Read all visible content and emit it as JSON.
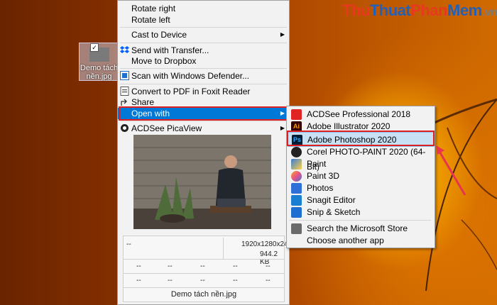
{
  "watermark": {
    "p1": "Thu",
    "p2": "Thuat",
    "p3": "Phan",
    "p4": "Mem",
    "p5": ".vn"
  },
  "desktop_icon": {
    "label": "Demo tách nền.jpg"
  },
  "menu": {
    "items": [
      {
        "label": "Rotate right"
      },
      {
        "label": "Rotate left"
      },
      {
        "label": "Cast to Device"
      },
      {
        "label": "Send with Transfer..."
      },
      {
        "label": "Move to Dropbox"
      },
      {
        "label": "Scan with Windows Defender..."
      },
      {
        "label": "Convert to PDF in Foxit Reader"
      },
      {
        "label": "Share"
      },
      {
        "label": "Open with"
      },
      {
        "label": "ACDSee PicaView"
      }
    ]
  },
  "preview_info": {
    "left_value": "--",
    "dimensions": "1920x1280x24b",
    "size": "944.2 KB",
    "grid": [
      "--",
      "--",
      "--",
      "--",
      "--",
      "--",
      "--",
      "--",
      "--",
      "--"
    ],
    "filename": "Demo tách nền.jpg"
  },
  "submenu": {
    "items": [
      {
        "label": "ACDSee Professional 2018",
        "icon": "acdsee-icon",
        "color": "#e02424"
      },
      {
        "label": "Adobe Illustrator 2020",
        "icon": "illustrator-icon",
        "color": "#ff9a00"
      },
      {
        "label": "Adobe Photoshop 2020",
        "icon": "photoshop-icon",
        "color": "#31a8ff"
      },
      {
        "label": "Corel PHOTO-PAINT 2020 (64-Bit)",
        "icon": "corel-icon",
        "color": "#d02020"
      },
      {
        "label": "Paint",
        "icon": "paint-icon",
        "color": "#3a7bd5"
      },
      {
        "label": "Paint 3D",
        "icon": "paint3d-icon",
        "color": "#e8508a"
      },
      {
        "label": "Photos",
        "icon": "photos-icon",
        "color": "#2f6fd8"
      },
      {
        "label": "Snagit Editor",
        "icon": "snagit-icon",
        "color": "#1a7fd0"
      },
      {
        "label": "Snip & Sketch",
        "icon": "snip-icon",
        "color": "#1f6fd0"
      },
      {
        "label": "Search the Microsoft Store",
        "icon": "store-icon",
        "color": "#6a6a6a"
      },
      {
        "label": "Choose another app",
        "icon": "",
        "color": ""
      }
    ]
  }
}
